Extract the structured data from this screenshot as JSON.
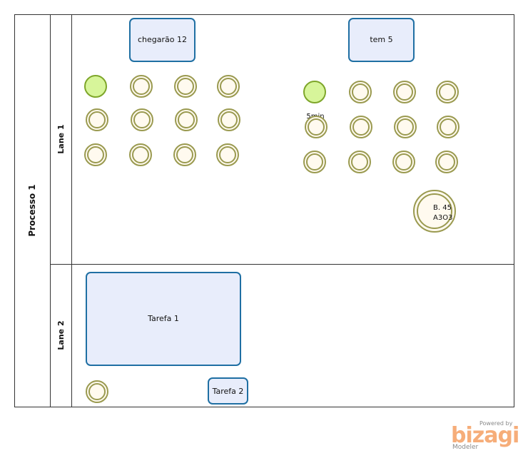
{
  "pool": {
    "label": "Processo 1"
  },
  "lanes": [
    {
      "id": "lane1",
      "label": "Lane 1"
    },
    {
      "id": "lane2",
      "label": "Lane 2"
    }
  ],
  "tasks": [
    {
      "id": "task-chegarao",
      "label": "chegarão 12"
    },
    {
      "id": "task-tem5",
      "label": "tem 5"
    },
    {
      "id": "task-tarefa1",
      "label": "Tarefa 1"
    },
    {
      "id": "task-tarefa2",
      "label": "Tarefa 2"
    }
  ],
  "events": {
    "start_timer_label": "5min",
    "intermediate_label_line1": "B. 45",
    "intermediate_label_line2": "A3O3"
  },
  "colors": {
    "task_fill": "#e8edfb",
    "task_stroke": "#1f6fa3",
    "event_fill": "#fffaef",
    "event_stroke": "#9a9a50",
    "start_fill": "#d7f59a",
    "start_stroke": "#7ea62a",
    "line": "#333333"
  },
  "branding": {
    "powered_by": "Powered by",
    "brand": "bizagi",
    "product": "Modeler"
  }
}
